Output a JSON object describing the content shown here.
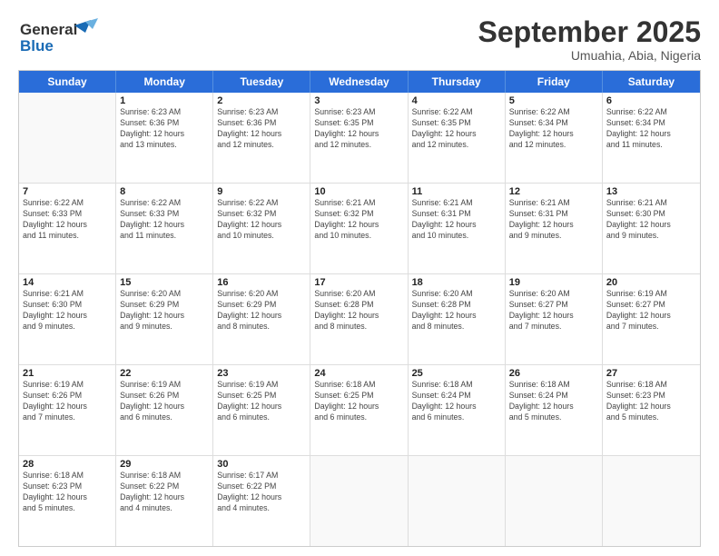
{
  "logo": {
    "line1": "General",
    "line2": "Blue"
  },
  "title": "September 2025",
  "location": "Umuahia, Abia, Nigeria",
  "days_of_week": [
    "Sunday",
    "Monday",
    "Tuesday",
    "Wednesday",
    "Thursday",
    "Friday",
    "Saturday"
  ],
  "weeks": [
    [
      {
        "day": "",
        "info": ""
      },
      {
        "day": "1",
        "info": "Sunrise: 6:23 AM\nSunset: 6:36 PM\nDaylight: 12 hours\nand 13 minutes."
      },
      {
        "day": "2",
        "info": "Sunrise: 6:23 AM\nSunset: 6:36 PM\nDaylight: 12 hours\nand 12 minutes."
      },
      {
        "day": "3",
        "info": "Sunrise: 6:23 AM\nSunset: 6:35 PM\nDaylight: 12 hours\nand 12 minutes."
      },
      {
        "day": "4",
        "info": "Sunrise: 6:22 AM\nSunset: 6:35 PM\nDaylight: 12 hours\nand 12 minutes."
      },
      {
        "day": "5",
        "info": "Sunrise: 6:22 AM\nSunset: 6:34 PM\nDaylight: 12 hours\nand 12 minutes."
      },
      {
        "day": "6",
        "info": "Sunrise: 6:22 AM\nSunset: 6:34 PM\nDaylight: 12 hours\nand 11 minutes."
      }
    ],
    [
      {
        "day": "7",
        "info": "Sunrise: 6:22 AM\nSunset: 6:33 PM\nDaylight: 12 hours\nand 11 minutes."
      },
      {
        "day": "8",
        "info": "Sunrise: 6:22 AM\nSunset: 6:33 PM\nDaylight: 12 hours\nand 11 minutes."
      },
      {
        "day": "9",
        "info": "Sunrise: 6:22 AM\nSunset: 6:32 PM\nDaylight: 12 hours\nand 10 minutes."
      },
      {
        "day": "10",
        "info": "Sunrise: 6:21 AM\nSunset: 6:32 PM\nDaylight: 12 hours\nand 10 minutes."
      },
      {
        "day": "11",
        "info": "Sunrise: 6:21 AM\nSunset: 6:31 PM\nDaylight: 12 hours\nand 10 minutes."
      },
      {
        "day": "12",
        "info": "Sunrise: 6:21 AM\nSunset: 6:31 PM\nDaylight: 12 hours\nand 9 minutes."
      },
      {
        "day": "13",
        "info": "Sunrise: 6:21 AM\nSunset: 6:30 PM\nDaylight: 12 hours\nand 9 minutes."
      }
    ],
    [
      {
        "day": "14",
        "info": "Sunrise: 6:21 AM\nSunset: 6:30 PM\nDaylight: 12 hours\nand 9 minutes."
      },
      {
        "day": "15",
        "info": "Sunrise: 6:20 AM\nSunset: 6:29 PM\nDaylight: 12 hours\nand 9 minutes."
      },
      {
        "day": "16",
        "info": "Sunrise: 6:20 AM\nSunset: 6:29 PM\nDaylight: 12 hours\nand 8 minutes."
      },
      {
        "day": "17",
        "info": "Sunrise: 6:20 AM\nSunset: 6:28 PM\nDaylight: 12 hours\nand 8 minutes."
      },
      {
        "day": "18",
        "info": "Sunrise: 6:20 AM\nSunset: 6:28 PM\nDaylight: 12 hours\nand 8 minutes."
      },
      {
        "day": "19",
        "info": "Sunrise: 6:20 AM\nSunset: 6:27 PM\nDaylight: 12 hours\nand 7 minutes."
      },
      {
        "day": "20",
        "info": "Sunrise: 6:19 AM\nSunset: 6:27 PM\nDaylight: 12 hours\nand 7 minutes."
      }
    ],
    [
      {
        "day": "21",
        "info": "Sunrise: 6:19 AM\nSunset: 6:26 PM\nDaylight: 12 hours\nand 7 minutes."
      },
      {
        "day": "22",
        "info": "Sunrise: 6:19 AM\nSunset: 6:26 PM\nDaylight: 12 hours\nand 6 minutes."
      },
      {
        "day": "23",
        "info": "Sunrise: 6:19 AM\nSunset: 6:25 PM\nDaylight: 12 hours\nand 6 minutes."
      },
      {
        "day": "24",
        "info": "Sunrise: 6:18 AM\nSunset: 6:25 PM\nDaylight: 12 hours\nand 6 minutes."
      },
      {
        "day": "25",
        "info": "Sunrise: 6:18 AM\nSunset: 6:24 PM\nDaylight: 12 hours\nand 6 minutes."
      },
      {
        "day": "26",
        "info": "Sunrise: 6:18 AM\nSunset: 6:24 PM\nDaylight: 12 hours\nand 5 minutes."
      },
      {
        "day": "27",
        "info": "Sunrise: 6:18 AM\nSunset: 6:23 PM\nDaylight: 12 hours\nand 5 minutes."
      }
    ],
    [
      {
        "day": "28",
        "info": "Sunrise: 6:18 AM\nSunset: 6:23 PM\nDaylight: 12 hours\nand 5 minutes."
      },
      {
        "day": "29",
        "info": "Sunrise: 6:18 AM\nSunset: 6:22 PM\nDaylight: 12 hours\nand 4 minutes."
      },
      {
        "day": "30",
        "info": "Sunrise: 6:17 AM\nSunset: 6:22 PM\nDaylight: 12 hours\nand 4 minutes."
      },
      {
        "day": "",
        "info": ""
      },
      {
        "day": "",
        "info": ""
      },
      {
        "day": "",
        "info": ""
      },
      {
        "day": "",
        "info": ""
      }
    ]
  ]
}
